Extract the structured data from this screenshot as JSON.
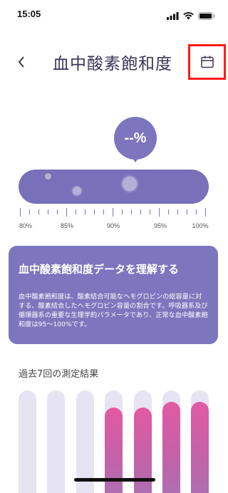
{
  "status_bar": {
    "time": "15:05"
  },
  "header": {
    "title": "血中酸素飽和度"
  },
  "reading": {
    "value": "--%"
  },
  "scale": {
    "labels": [
      "80%",
      "85%",
      "90%",
      "95%",
      "100%"
    ]
  },
  "info_card": {
    "title": "血中酸素飽和度データを理解する",
    "body": "血中酸素飽和度は、酸素結合可能なヘモグロビンの総容量に対する、酸素結合したヘモグロビン容量の割合です。呼吸器系及び循環器系の重要な生理学的パラメータであり、正常な血中酸素飽和度は95〜100%です。"
  },
  "history": {
    "title": "過去7回の測定結果",
    "fill_fraction": [
      0,
      0,
      0,
      0.85,
      0.85,
      0.9,
      0.9
    ]
  },
  "colors": {
    "accent": "#7d75bd",
    "bar_track": "#e6e4f3",
    "bar_fill_top": "#e25aa3",
    "bar_fill_bottom": "#a972b4",
    "highlight": "#ff1a1a"
  }
}
